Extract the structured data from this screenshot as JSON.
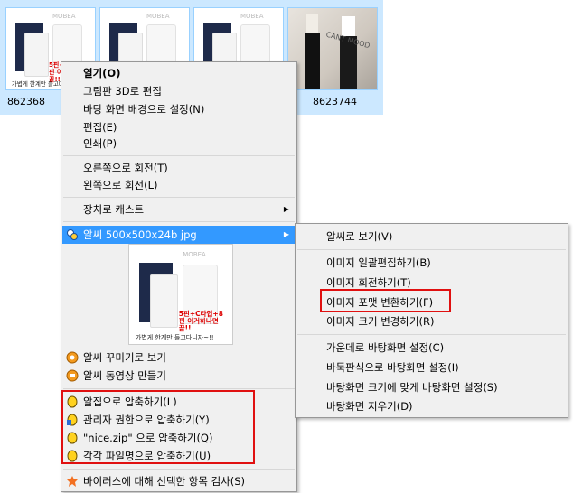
{
  "thumbnails": {
    "labels": [
      "862368",
      "8623744"
    ],
    "product_caption": "가볍게 한계만 들고다니자~!!",
    "product_red_text": "5핀+C타입+8핀 이거하나면 끝!!",
    "product_logo": "MOBEA",
    "photo_sign": "CANT MOOD"
  },
  "menu": {
    "items": [
      {
        "label": "열기(O)",
        "bold": true
      },
      {
        "label": "그림판 3D로 편집"
      },
      {
        "label": "바탕 화면 배경으로 설정(N)"
      },
      {
        "label": "편집(E)"
      },
      {
        "label": "인쇄(P)"
      },
      {
        "label": "오른쪽으로 회전(T)"
      },
      {
        "label": "왼쪽으로 회전(L)"
      },
      {
        "label": "장치로 캐스트"
      },
      {
        "label": "알씨 500x500x24b jpg"
      },
      {
        "label": "알씨 꾸미기로 보기"
      },
      {
        "label": "알씨 동영상 만들기"
      },
      {
        "label": "알집으로 압축하기(L)"
      },
      {
        "label": "관리자 권한으로 압축하기(Y)"
      },
      {
        "label": "\"nice.zip\" 으로 압축하기(Q)"
      },
      {
        "label": "각각 파일명으로 압축하기(U)"
      },
      {
        "label": "바이러스에 대해 선택한 항목 검사(S)"
      }
    ]
  },
  "submenu": {
    "items": [
      {
        "label": "알씨로 보기(V)"
      },
      {
        "label": "이미지 일괄편집하기(B)"
      },
      {
        "label": "이미지 회전하기(T)"
      },
      {
        "label": "이미지 포맷 변환하기(F)"
      },
      {
        "label": "이미지 크기 변경하기(R)"
      },
      {
        "label": "가운데로 바탕화면 설정(C)"
      },
      {
        "label": "바둑판식으로 바탕화면 설정(I)"
      },
      {
        "label": "바탕화면 크기에 맞게 바탕화면 설정(S)"
      },
      {
        "label": "바탕화면 지우기(D)"
      }
    ]
  },
  "colors": {
    "highlight": "#3399ff",
    "annotation_red": "#e01010",
    "selection_bg": "#cce8ff"
  }
}
